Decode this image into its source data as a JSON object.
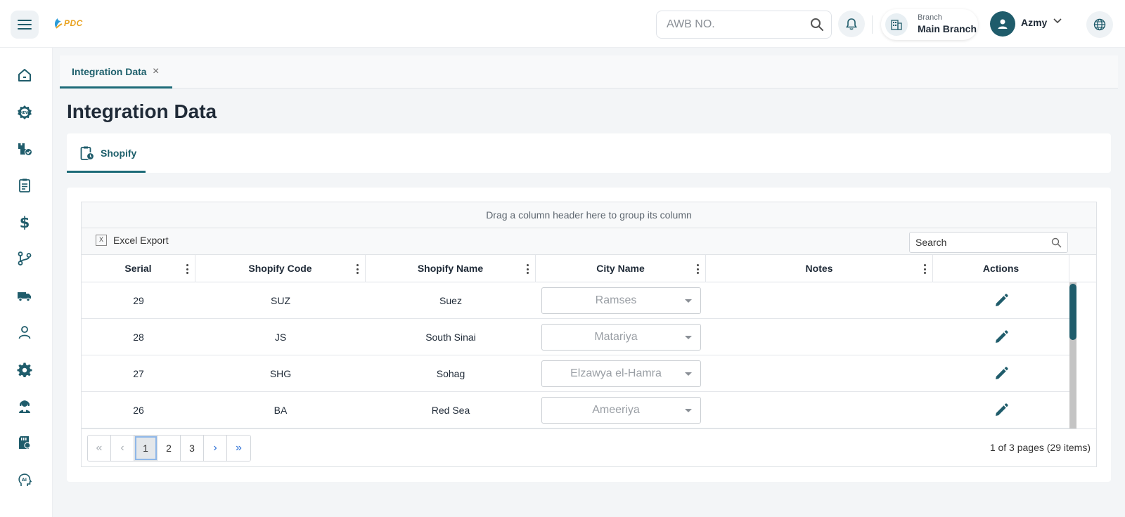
{
  "header": {
    "logo_text": "PDC",
    "awb_placeholder": "AWB NO.",
    "branch_label": "Branch",
    "branch_name": "Main Branch",
    "user_name": "Azmy"
  },
  "sidebar": {
    "items": [
      {
        "icon": "home-icon"
      },
      {
        "icon": "new-badge-icon"
      },
      {
        "icon": "packages-check-icon"
      },
      {
        "icon": "clipboard-list-icon"
      },
      {
        "icon": "dollar-icon"
      },
      {
        "icon": "git-branch-icon"
      },
      {
        "icon": "truck-icon"
      },
      {
        "icon": "user-icon"
      },
      {
        "icon": "gear-icon"
      },
      {
        "icon": "support-agent-icon"
      },
      {
        "icon": "sd-card-icon"
      },
      {
        "icon": "ai-head-icon"
      }
    ]
  },
  "tabs": [
    {
      "label": "Integration Data",
      "close": "×"
    }
  ],
  "page": {
    "title": "Integration Data"
  },
  "subtabs": [
    {
      "label": "Shopify"
    }
  ],
  "grid": {
    "group_panel_text": "Drag a column header here to group its column",
    "excel_icon_text": "X",
    "excel_export_label": "Excel Export",
    "search_placeholder": "Search",
    "columns": [
      "Serial",
      "Shopify Code",
      "Shopify Name",
      "City Name",
      "Notes",
      "Actions"
    ],
    "rows": [
      {
        "serial": "29",
        "code": "SUZ",
        "name": "Suez",
        "city": "Ramses",
        "notes": ""
      },
      {
        "serial": "28",
        "code": "JS",
        "name": "South Sinai",
        "city": "Matariya",
        "notes": ""
      },
      {
        "serial": "27",
        "code": "SHG",
        "name": "Sohag",
        "city": "Elzawya el-Hamra",
        "notes": ""
      },
      {
        "serial": "26",
        "code": "BA",
        "name": "Red Sea",
        "city": "Ameeriya",
        "notes": ""
      }
    ],
    "pager": {
      "first": "«",
      "prev": "‹",
      "pages": [
        "1",
        "2",
        "3"
      ],
      "current_page": "1",
      "next": "›",
      "last": "»",
      "info": "1 of 3 pages (29 items)"
    }
  },
  "colors": {
    "accent": "#1d6b78",
    "avatar": "#1f5c6b",
    "logo": "#e9a321"
  }
}
